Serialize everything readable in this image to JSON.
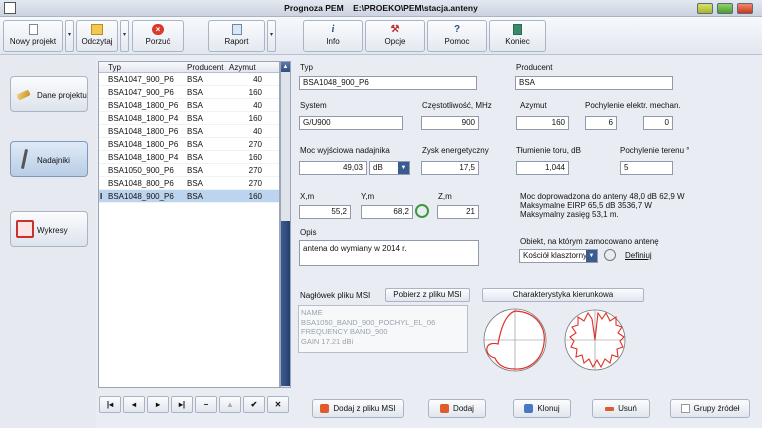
{
  "window": {
    "title": "Prognoza PEM    E:\\PROEKO\\PEM\\stacja.anteny"
  },
  "toolbar": {
    "new_project": "Nowy projekt",
    "open": "Odczytaj",
    "discard": "Porzuć",
    "report": "Raport",
    "info": "Info",
    "options": "Opcje",
    "help": "Pomoc",
    "end": "Koniec"
  },
  "leftnav": {
    "project_data": "Dane projektu",
    "transmitters": "Nadajniki",
    "charts": "Wykresy"
  },
  "table": {
    "headers": {
      "type": "Typ",
      "producer": "Producent",
      "azimuth": "Azymut"
    },
    "rows": [
      {
        "type": "BSA1047_900_P6",
        "producer": "BSA",
        "azimuth": "40"
      },
      {
        "type": "BSA1047_900_P6",
        "producer": "BSA",
        "azimuth": "160"
      },
      {
        "type": "BSA1048_1800_P6",
        "producer": "BSA",
        "azimuth": "40"
      },
      {
        "type": "BSA1048_1800_P4",
        "producer": "BSA",
        "azimuth": "160"
      },
      {
        "type": "BSA1048_1800_P6",
        "producer": "BSA",
        "azimuth": "40"
      },
      {
        "type": "BSA1048_1800_P6",
        "producer": "BSA",
        "azimuth": "270"
      },
      {
        "type": "BSA1048_1800_P4",
        "producer": "BSA",
        "azimuth": "160"
      },
      {
        "type": "BSA1050_900_P6",
        "producer": "BSA",
        "azimuth": "270"
      },
      {
        "type": "BSA1048_800_P6",
        "producer": "BSA",
        "azimuth": "270"
      },
      {
        "type": "BSA1048_900_P6",
        "producer": "BSA",
        "azimuth": "160",
        "selected": true,
        "marker": "I"
      }
    ]
  },
  "form": {
    "type_label": "Typ",
    "type_value": "BSA1048_900_P6",
    "producer_label": "Producent",
    "producer_value": "BSA",
    "system_label": "System",
    "system_value": "G/U900",
    "freq_label": "Częstotliwość, MHz",
    "freq_value": "900",
    "azimuth_label": "Azymut",
    "azimuth_value": "160",
    "tilt_label": "Pochylenie elektr.  mechan.",
    "tilt_elec": "6",
    "tilt_mech": "0",
    "power_label": "Moc wyjściowa nadajnika",
    "power_value": "49,03",
    "power_unit": "dB",
    "gain_label": "Zysk energetyczny",
    "gain_value": "17,5",
    "att_label": "Tłumienie toru, dB",
    "att_value": "1,044",
    "terrain_label": "Pochylenie terenu °",
    "terrain_value": "5",
    "x_label": "X,m",
    "x_value": "55,2",
    "y_label": "Y,m",
    "y_value": "68,2",
    "z_label": "Z,m",
    "z_value": "21",
    "info_power": "Moc doprowadzona do anteny 48,0 dB  62,9 W",
    "info_eirp": "Maksymalne EIRP 65,5 dB  3536,7 W",
    "info_range": "Maksymalny zasięg 53,1 m.",
    "desc_label": "Opis",
    "desc_value": "antena do wymiany w 2014 r.",
    "object_label": "Obiekt, na którym zamocowano antenę",
    "object_value": "Kościół klasztorny",
    "define_link": "Definiuj",
    "msi_label": "Nagłówek pliku MSI",
    "msi_fetch": "Pobierz z pliku MSI",
    "pattern_btn": "Charakterystyka kierunkowa",
    "msi_lines": [
      "NAME",
      "BSA1050_BAND_900_POCHYL_EL_06",
      "FREQUENCY BAND_900",
      "GAIN 17.21 dBi"
    ]
  },
  "bottom": {
    "add_msi": "Dodaj z pliku MSI",
    "add": "Dodaj",
    "clone": "Klonuj",
    "remove": "Usuń",
    "groups": "Grupy źródeł"
  },
  "colors": {
    "selection": "#bcd4ee",
    "pattern": "#e0302a",
    "accent": "#2f4f86"
  }
}
